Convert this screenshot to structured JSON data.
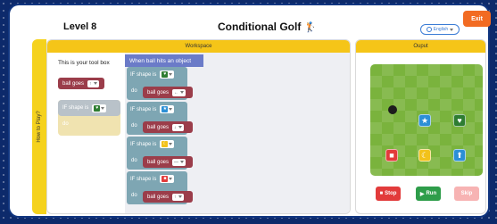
{
  "header": {
    "level": "Level 8",
    "title": "Conditional Golf",
    "exit_label": "Exit",
    "language": "English"
  },
  "sidebar": {
    "how_to_play": "How to Play?"
  },
  "workspace": {
    "title": "Workspace",
    "toolbox_label": "This is your tool box",
    "toolbox_blocks": {
      "ball_goes": {
        "label": "ball goes",
        "arrow": "↑"
      },
      "if_block": {
        "label": "IF shape is",
        "do_label": "do"
      }
    },
    "event_label": "When ball hits an object",
    "conditions": [
      {
        "if_label": "IF shape is",
        "shape": "heart",
        "shape_color": "#2e7d32",
        "do_label": "do",
        "action_label": "ball goes",
        "direction": "←"
      },
      {
        "if_label": "IF shape is",
        "shape": "star",
        "shape_color": "#2c8fd6",
        "do_label": "do",
        "action_label": "ball goes",
        "direction": "↓"
      },
      {
        "if_label": "IF shape is",
        "shape": "moon",
        "shape_color": "#f2c21b",
        "do_label": "do",
        "action_label": "ball goes",
        "direction": "—"
      },
      {
        "if_label": "IF shape is",
        "shape": "square",
        "shape_color": "#e23b3b",
        "do_label": "do",
        "action_label": "ball goes",
        "direction": "↑"
      }
    ]
  },
  "output": {
    "title": "Ouput",
    "tiles": [
      {
        "shape": "star",
        "glyph": "★",
        "color": "#2c8fd6"
      },
      {
        "shape": "heart",
        "glyph": "♥",
        "color": "#2e7d32"
      },
      {
        "shape": "square",
        "glyph": "■",
        "color": "#e23b3b"
      },
      {
        "shape": "moon",
        "glyph": "☾",
        "color": "#f2c21b"
      },
      {
        "shape": "up-arrow",
        "glyph": "⬆",
        "color": "#2c8fd6"
      }
    ],
    "buttons": {
      "stop": {
        "label": "Stop",
        "icon": "■",
        "color": "#e23b3b"
      },
      "run": {
        "label": "Run",
        "icon": "▶",
        "color": "#2e9d4a"
      },
      "skip": {
        "label": "Skip",
        "color": "#f7b3b3"
      }
    }
  }
}
